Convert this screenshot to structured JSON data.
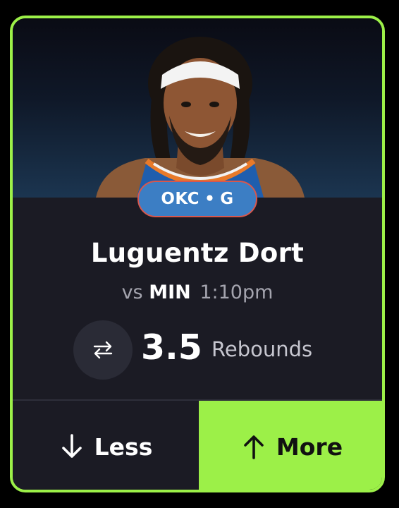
{
  "player": {
    "team": "OKC",
    "position": "G",
    "badge_separator": "•",
    "name": "Luguentz Dort",
    "photo_icon": "player-headshot"
  },
  "game": {
    "vs_label": "vs",
    "opponent": "MIN",
    "time": "1:10pm"
  },
  "projection": {
    "swap_icon": "swap-arrows-icon",
    "line": "3.5",
    "stat": "Rebounds"
  },
  "actions": {
    "less_label": "Less",
    "less_icon": "arrow-down-icon",
    "more_label": "More",
    "more_icon": "arrow-up-icon"
  },
  "colors": {
    "accent": "#9cf048",
    "card_bg": "#1b1b24",
    "badge_bg": "#3c7ec4",
    "badge_border": "#d9574c"
  }
}
